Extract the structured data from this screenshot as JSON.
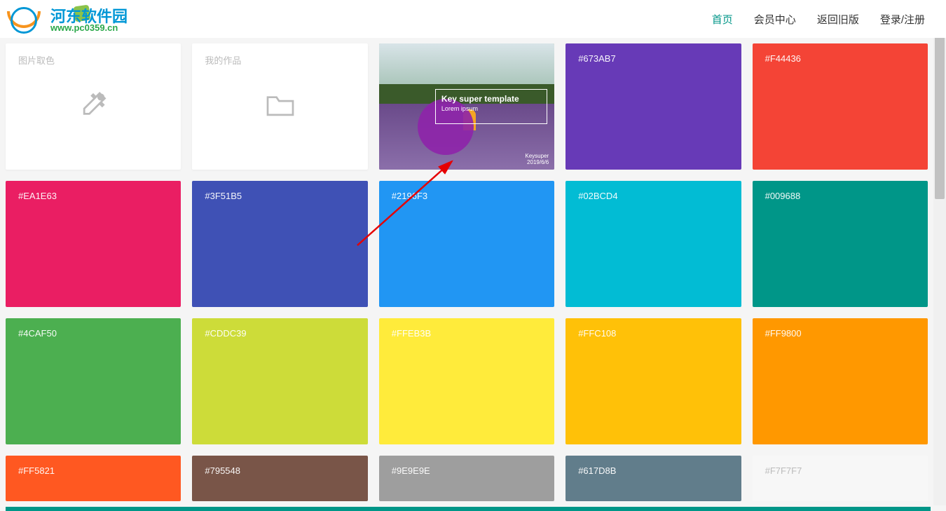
{
  "logo": {
    "text": "河东软件园",
    "url": "www.pc0359.cn"
  },
  "nav": {
    "home": "首页",
    "member": "会员中心",
    "oldver": "返回旧版",
    "login": "登录/注册"
  },
  "tools": {
    "picker": "图片取色",
    "works": "我的作品"
  },
  "template": {
    "title": "Key super template",
    "subtitle": "Lorem ipsum",
    "footer1": "Keysuper",
    "footer2": "2019/6/6"
  },
  "colors": {
    "c673AB7": "#673AB7",
    "cF44436": "#F44436",
    "cEA1E63": "#EA1E63",
    "c3F51B5": "#3F51B5",
    "c2196F3": "#2196F3",
    "c02BCD4": "#02BCD4",
    "c009688": "#009688",
    "c4CAF50": "#4CAF50",
    "cCDDC39": "#CDDC39",
    "cFFEB3B": "#FFEB3B",
    "cFFC108": "#FFC108",
    "cFF9800": "#FF9800",
    "cFF5821": "#FF5821",
    "c795548": "#795548",
    "c9E9E9E": "#9E9E9E",
    "c617D8B": "#617D8B",
    "cF7F7F7": "#F7F7F7"
  }
}
